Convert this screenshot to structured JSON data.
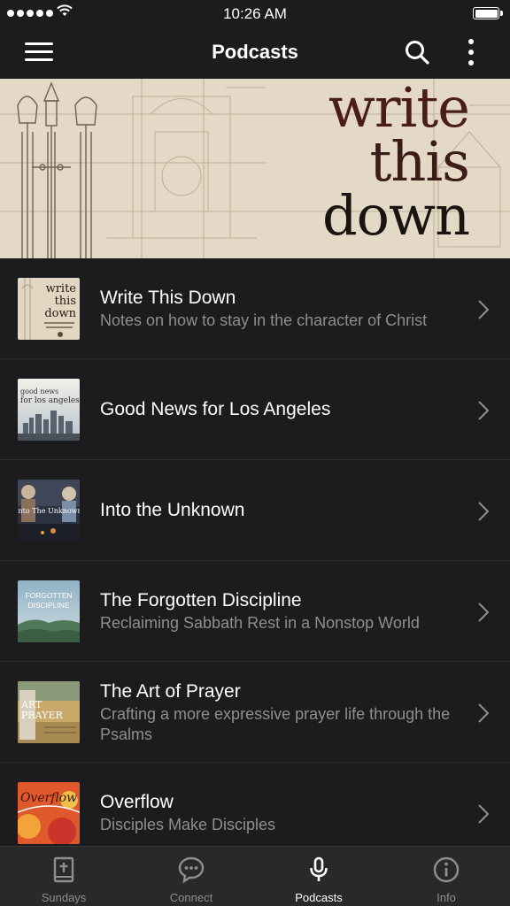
{
  "status_bar": {
    "time": "10:26 AM"
  },
  "nav": {
    "title": "Podcasts"
  },
  "hero": {
    "title_lines": [
      "write",
      "this",
      "down"
    ]
  },
  "podcasts": [
    {
      "title": "Write This Down",
      "subtitle": "Notes on how to stay in the character of Christ",
      "thumb_text": [
        "write",
        "this",
        "down"
      ]
    },
    {
      "title": "Good News for Los Angeles",
      "subtitle": "",
      "thumb_text": [
        "good news",
        "for los angeles"
      ]
    },
    {
      "title": "Into the Unknown",
      "subtitle": "",
      "thumb_text": [
        "Into The Unknown"
      ]
    },
    {
      "title": "The Forgotten Discipline",
      "subtitle": "Reclaiming Sabbath Rest in a Nonstop World",
      "thumb_text": [
        "FORGOTTEN",
        "DISCIPLINE"
      ]
    },
    {
      "title": "The Art of Prayer",
      "subtitle": "Crafting a more expressive prayer life through the Psalms",
      "thumb_text": [
        "ART",
        "PRAYER"
      ]
    },
    {
      "title": "Overflow",
      "subtitle": "Disciples Make Disciples",
      "thumb_text": [
        "Overflow"
      ]
    }
  ],
  "tabs": [
    {
      "label": "Sundays",
      "icon": "bible-icon",
      "active": false
    },
    {
      "label": "Connect",
      "icon": "chat-bubble-icon",
      "active": false
    },
    {
      "label": "Podcasts",
      "icon": "microphone-icon",
      "active": true
    },
    {
      "label": "Info",
      "icon": "info-icon",
      "active": false
    }
  ],
  "colors": {
    "background": "#1c1c1e",
    "tab_bar": "#29292c",
    "subtitle": "#8e8e93",
    "divider": "#2d2d30"
  }
}
